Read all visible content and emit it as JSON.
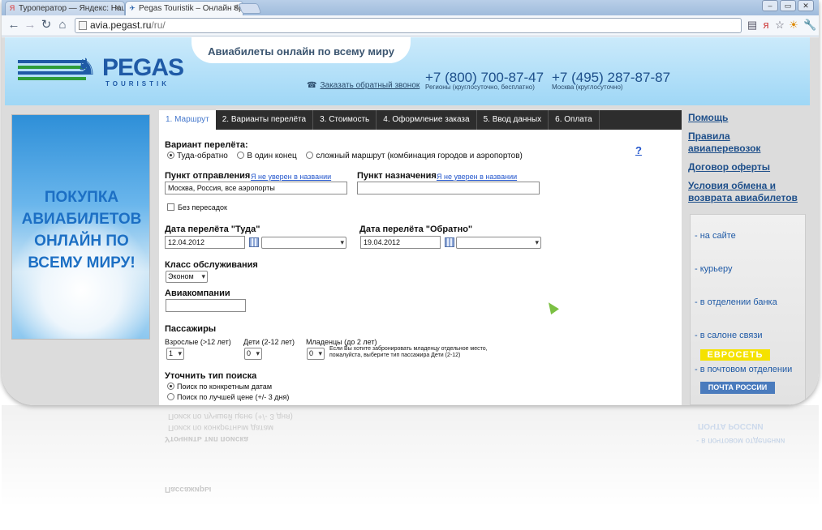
{
  "browser": {
    "tabs": [
      {
        "title": "Туроператор — Яндекс: Нац...",
        "active": false
      },
      {
        "title": "Pegas Touristik – Онлайн бро...",
        "active": true
      }
    ],
    "url": {
      "host": "avia.pegast.ru",
      "path": "/ru/"
    }
  },
  "header": {
    "tagline": "Авиабилеты онлайн по всему миру",
    "logo_name": "PEGAS",
    "logo_sub": "TOURISTIK",
    "callback": "Заказать обратный звонок",
    "phone1": "+7 (800) 700-87-47",
    "phone1_note": "Регионы (круглосуточно, бесплатно)",
    "phone2": "+7 (495) 287-87-87",
    "phone2_note": "Москва (круглосуточно)"
  },
  "banner": {
    "lines": [
      "ПОКУПКА",
      "АВИАБИЛЕТОВ",
      "ОНЛАЙН ПО",
      "ВСЕМУ МИРУ!"
    ]
  },
  "steps": [
    "1. Маршрут",
    "2. Варианты перелёта",
    "3. Стоимость",
    "4. Оформление заказа",
    "5. Ввод данных",
    "6. Оплата"
  ],
  "form": {
    "help": "?",
    "variant_label": "Вариант перелёта:",
    "variant_options": [
      "Туда-обратно",
      "В один конец",
      "сложный маршрут (комбинация городов и аэропортов)"
    ],
    "from_label": "Пункт отправления",
    "from_hint": "Я не уверен в названии",
    "from_value": "Москва, Россия, все аэропорты",
    "to_label": "Пункт назначения",
    "to_hint": "Я не уверен в названии",
    "to_value": "",
    "nonstop_label": "Без пересадок",
    "date_there_label": "Дата перелёта \"Туда\"",
    "date_there": "12.04.2012",
    "date_back_label": "Дата перелёта \"Обратно\"",
    "date_back": "19.04.2012",
    "class_label": "Класс обслуживания",
    "class_value": "Эконом",
    "airlines_label": "Авиакомпании",
    "pax_label": "Пассажиры",
    "adults_label": "Взрослые (>12 лет)",
    "adults_value": "1",
    "children_label": "Дети (2-12 лет)",
    "children_value": "0",
    "infants_label": "Младенцы (до 2 лет)",
    "infants_value": "0",
    "infants_note": "Если Вы хотите забронировать младенцу отдельное место, пожалуйста, выберите тип пассажира Дети (2-12)",
    "search_type_label": "Уточнить тип поиска",
    "search_options": [
      "Поиск по конкретным датам",
      "Поиск по лучшей цене (+/- 3 дня)"
    ]
  },
  "right": {
    "links": [
      "Помощь",
      "Правила авиаперевозок",
      "Договор оферты",
      "Условия обмена и возврата авиабилетов"
    ],
    "payment": [
      "- на сайте",
      "- курьеру",
      "- в отделении банка",
      "- в салоне связи",
      "- в почтовом отделении"
    ],
    "euroset": "ЕВРОСЕТЬ",
    "post": "ПОЧТА РОССИИ"
  }
}
